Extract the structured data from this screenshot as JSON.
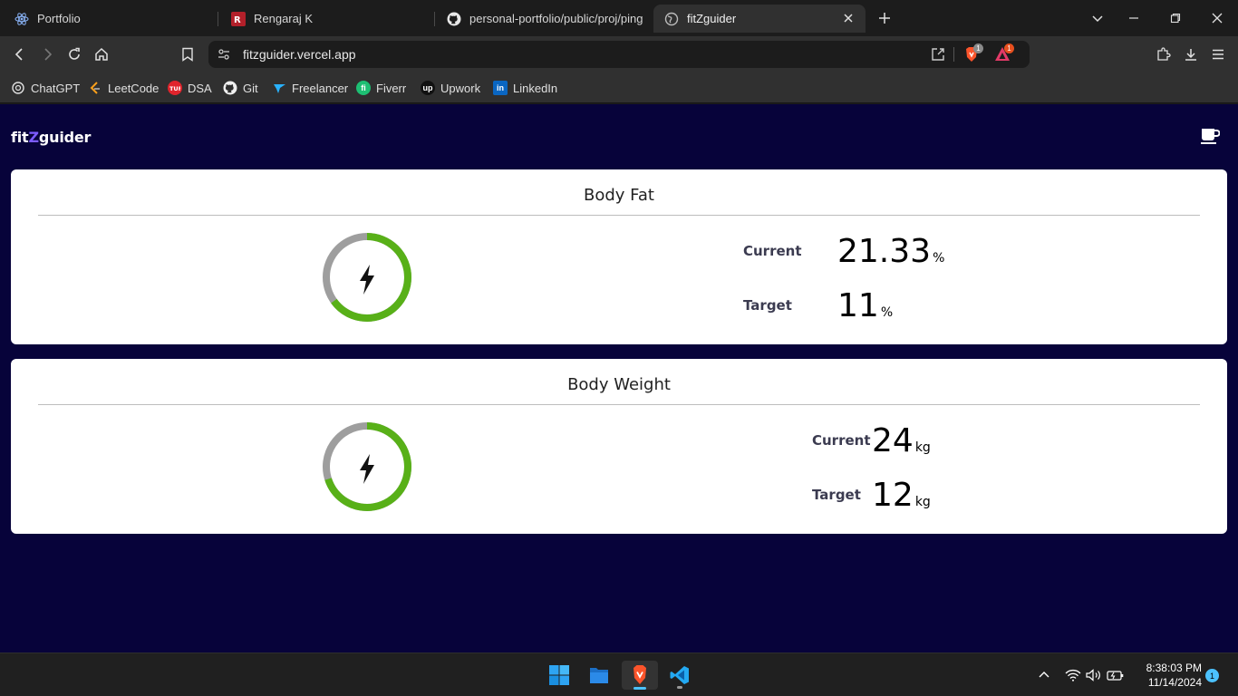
{
  "browser": {
    "tabs": [
      {
        "title": "Portfolio",
        "icon": "react-icon"
      },
      {
        "title": "Rengaraj K",
        "icon": "portfolio-r-icon"
      },
      {
        "title": "personal-portfolio/public/proj/ping",
        "icon": "github-icon"
      },
      {
        "title": "fitZguider",
        "icon": "globe-icon"
      }
    ],
    "url": "fitzguider.vercel.app",
    "shields_badge": "1",
    "rewards_badge": "1",
    "bookmarks": [
      {
        "label": "ChatGPT",
        "icon": "chatgpt-icon",
        "color": "#202020"
      },
      {
        "label": "LeetCode",
        "icon": "leetcode-icon",
        "color": "#f89f1b"
      },
      {
        "label": "DSA",
        "icon": "tuf-icon",
        "color": "#e0242c"
      },
      {
        "label": "Git",
        "icon": "github-icon",
        "color": "#ffffff"
      },
      {
        "label": "Freelancer",
        "icon": "freelancer-icon",
        "color": "#29b2fe"
      },
      {
        "label": "Fiverr",
        "icon": "fiverr-icon",
        "color": "#1dbf73"
      },
      {
        "label": "Upwork",
        "icon": "upwork-icon",
        "color": "#111111"
      },
      {
        "label": "LinkedIn",
        "icon": "linkedin-icon",
        "color": "#0a66c2"
      }
    ]
  },
  "app": {
    "brand_prefix": "fit",
    "brand_accent": "Z",
    "brand_suffix": "guider",
    "accent_color": "#7c5cff",
    "background_color": "#07033a",
    "cards": [
      {
        "title": "Body Fat",
        "progress": 0.65,
        "current_label": "Current",
        "current_value": "21.33",
        "current_unit": "%",
        "target_label": "Target",
        "target_value": "11",
        "target_unit": "%"
      },
      {
        "title": "Body Weight",
        "progress": 0.7,
        "current_label": "Current",
        "current_value": "24",
        "current_unit": "kg",
        "target_label": "Target",
        "target_value": "12",
        "target_unit": "kg"
      }
    ],
    "gauge_colors": {
      "fill": "#58b018",
      "track": "#9e9e9e"
    }
  },
  "taskbar": {
    "time": "8:38:03 PM",
    "date": "11/14/2024",
    "notifications": "1"
  }
}
